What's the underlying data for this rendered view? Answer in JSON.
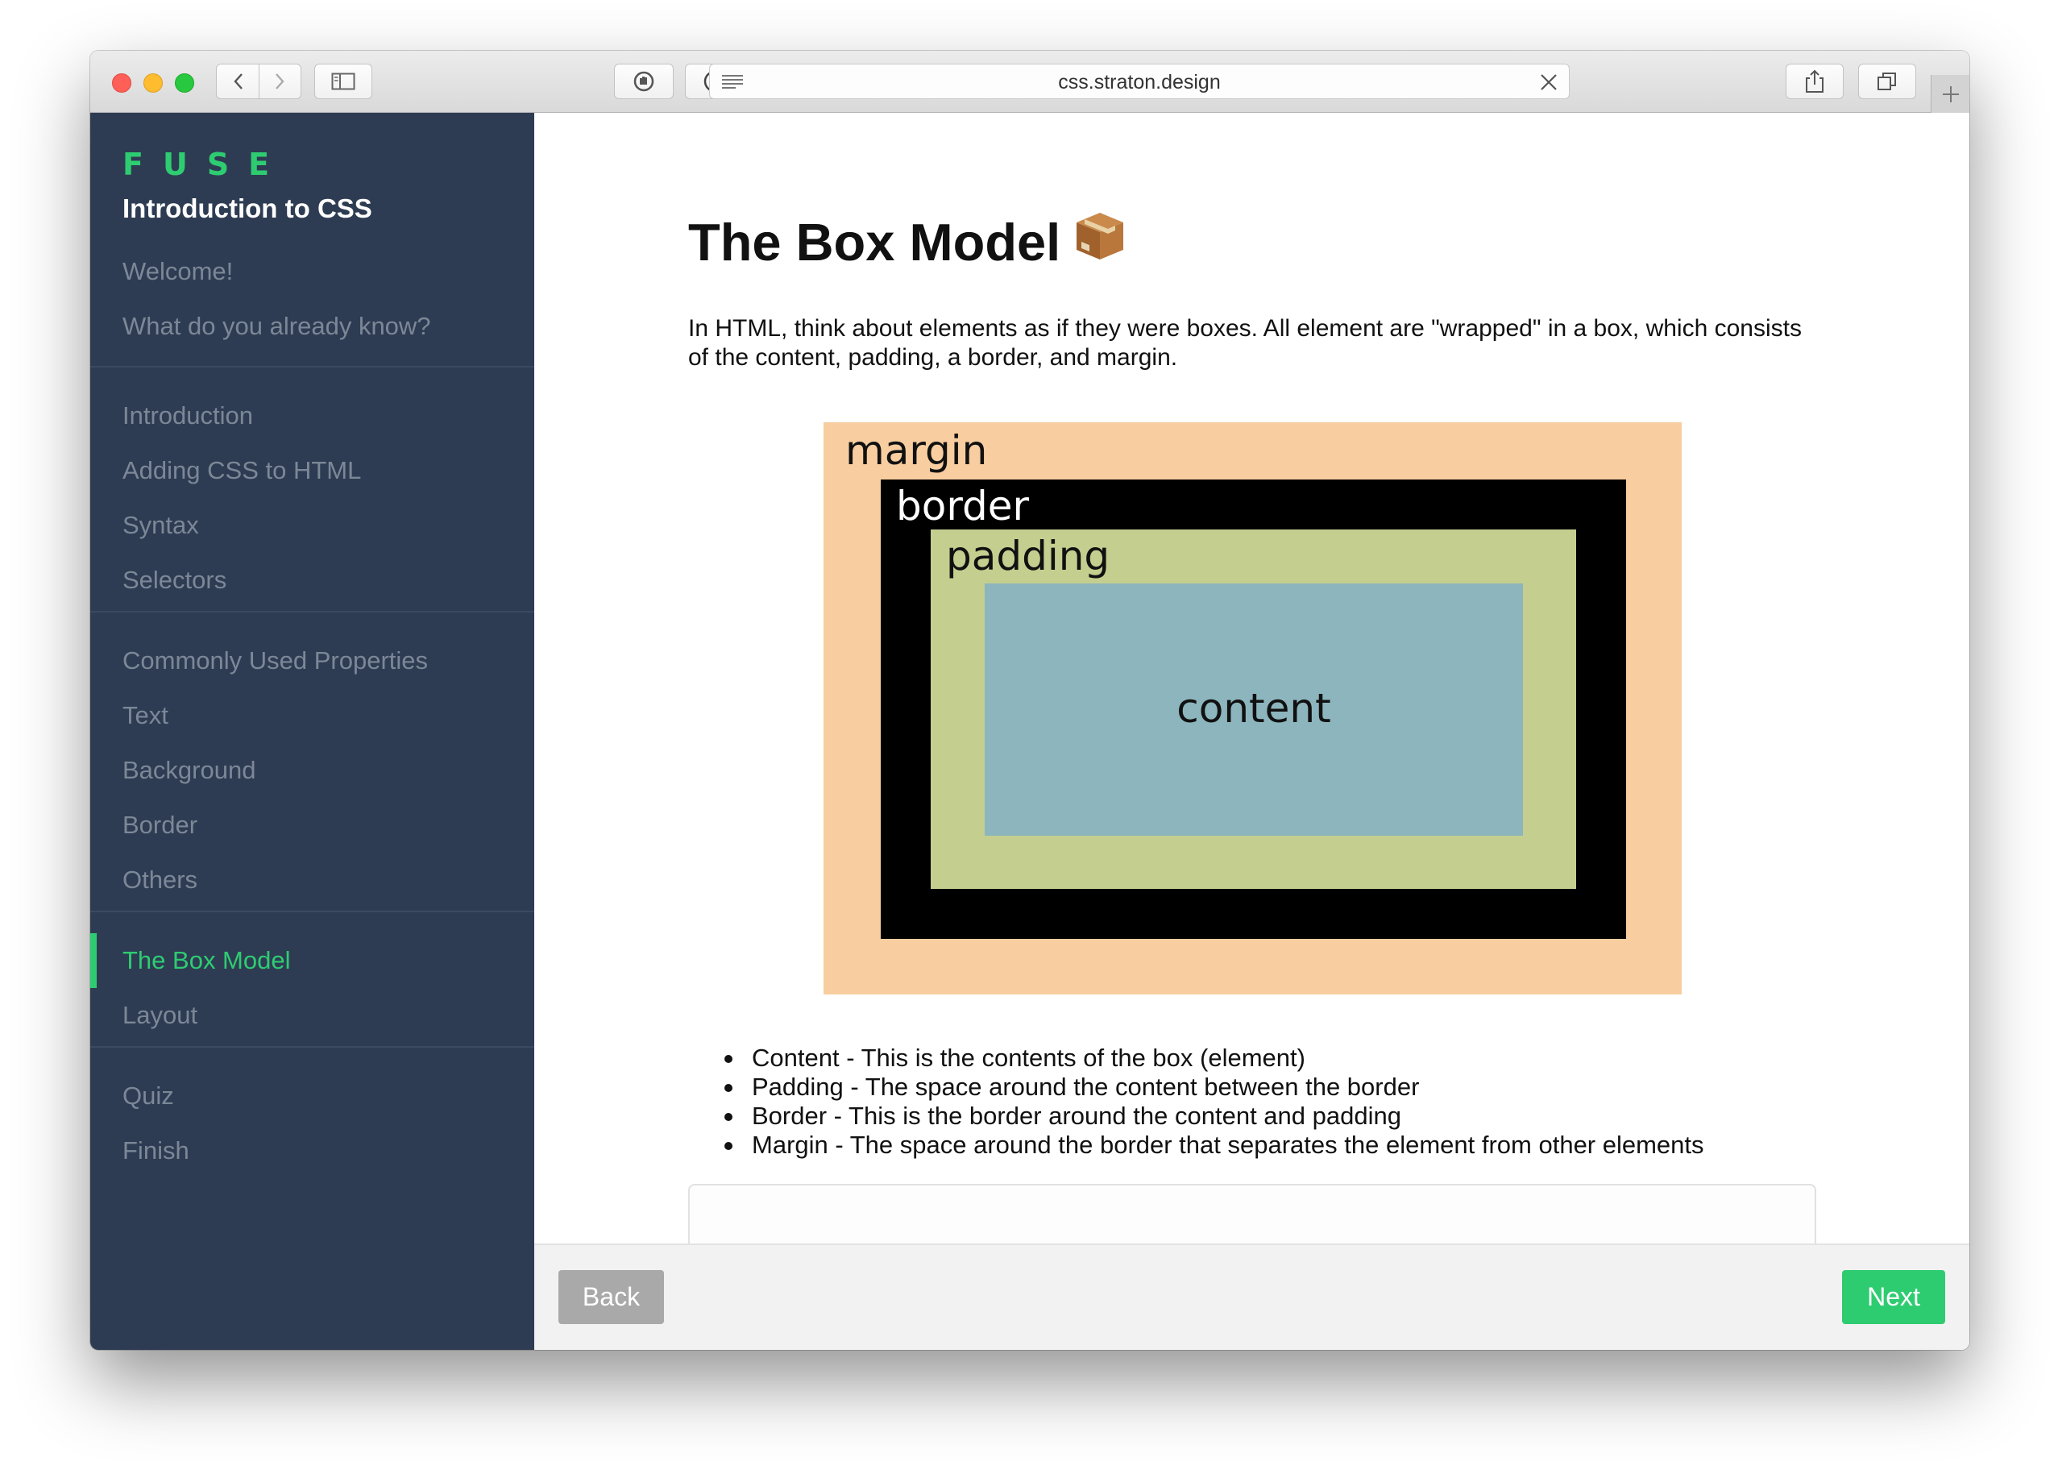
{
  "browser": {
    "url": "css.straton.design",
    "icons": [
      "back-icon",
      "forward-icon",
      "sidebar-icon",
      "shield-icon",
      "info-icon",
      "reader-icon",
      "close-icon",
      "share-icon",
      "tabs-icon",
      "plus-icon"
    ]
  },
  "sidebar": {
    "brand": "FUSE",
    "course_title": "Introduction to CSS",
    "groups": [
      {
        "items": [
          {
            "label": "Welcome!"
          },
          {
            "label": "What do you already know?"
          }
        ]
      },
      {
        "items": [
          {
            "label": "Introduction"
          },
          {
            "label": "Adding CSS to HTML"
          },
          {
            "label": "Syntax"
          },
          {
            "label": "Selectors"
          }
        ]
      },
      {
        "items": [
          {
            "label": "Commonly Used Properties"
          },
          {
            "label": "Text"
          },
          {
            "label": "Background"
          },
          {
            "label": "Border"
          },
          {
            "label": "Others"
          }
        ]
      },
      {
        "items": [
          {
            "label": "The Box Model",
            "active": true
          },
          {
            "label": "Layout"
          }
        ]
      },
      {
        "items": [
          {
            "label": "Quiz"
          },
          {
            "label": "Finish"
          }
        ]
      }
    ]
  },
  "main": {
    "title": "The Box Model",
    "title_emoji": "package",
    "intro": "In HTML, think about elements as if they were boxes. All element are \"wrapped\" in a box, which consists of the content, padding, a border, and margin.",
    "diagram": {
      "margin_label": "margin",
      "border_label": "border",
      "padding_label": "padding",
      "content_label": "content",
      "colors": {
        "margin": "#f8cd9f",
        "border": "#000000",
        "padding": "#c3ce8f",
        "content": "#8cb5bd"
      }
    },
    "bullets": [
      "Content - This is the contents of the box (element)",
      "Padding - The space around the content between the border",
      "Border - This is the border around the content and padding",
      "Margin - The space around the border that separates the element from other elements"
    ]
  },
  "footer": {
    "back_label": "Back",
    "next_label": "Next"
  },
  "colors": {
    "accent": "#2ecc71",
    "sidebar_bg": "#2e3c53",
    "nav_text": "#7c8797"
  }
}
